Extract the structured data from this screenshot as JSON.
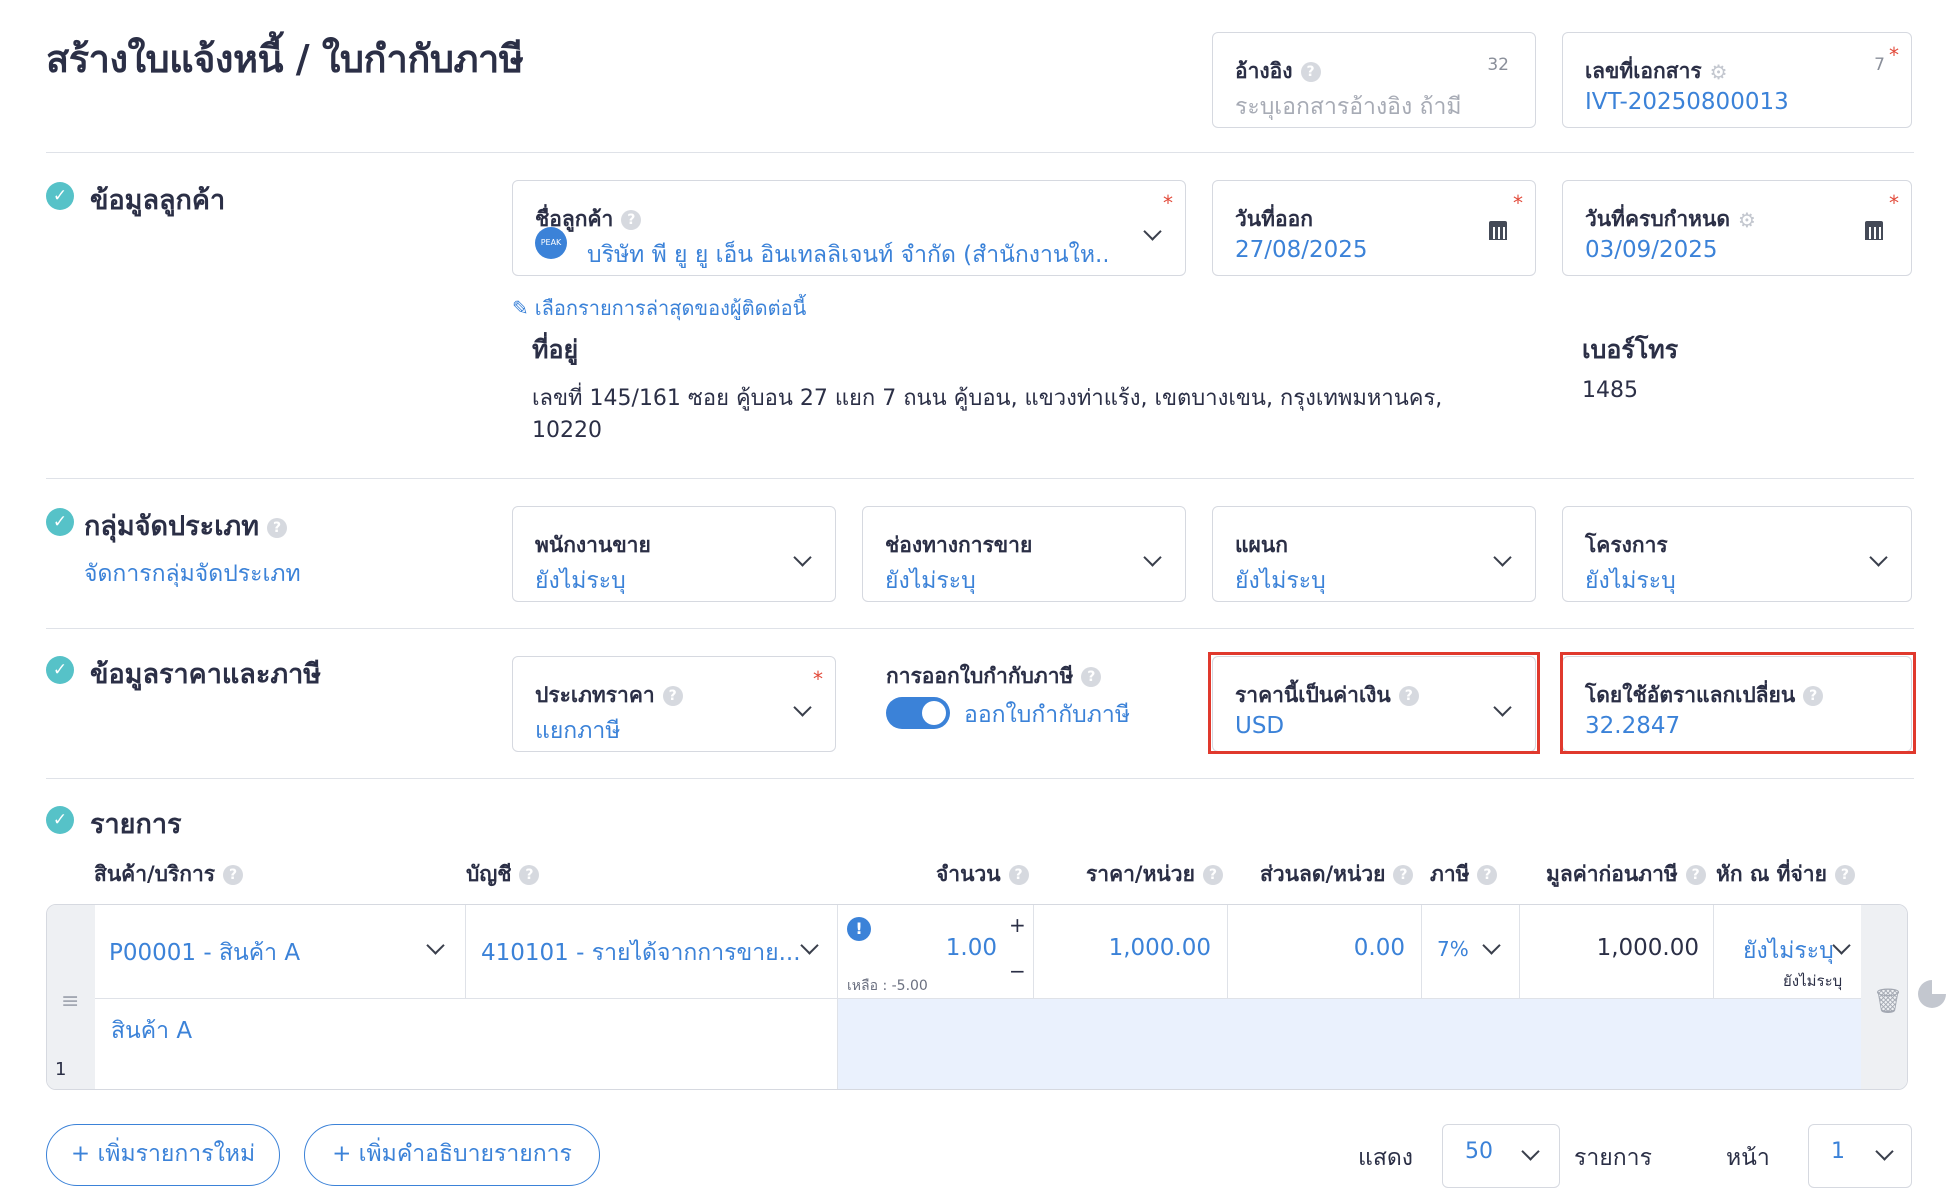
{
  "page": {
    "title": "สร้างใบแจ้งหนี้ / ใบกำกับภาษี"
  },
  "header": {
    "reference": {
      "label": "อ้างอิง",
      "placeholder": "ระบุเอกสารอ้างอิง ถ้ามี",
      "count": "32"
    },
    "doc_number": {
      "label": "เลขที่เอกสาร",
      "value": "IVT-20250800013",
      "count": "7"
    }
  },
  "customer": {
    "section_title": "ข้อมูลลูกค้า",
    "name_label": "ชื่อลูกค้า",
    "name_value": "บริษัท พี ยู ยู เอ็น อินเทลลิเจนท์ จำกัด (สำนักงานให...",
    "logo_text": "PEAK",
    "issue_date_label": "วันที่ออก",
    "issue_date": "27/08/2025",
    "due_date_label": "วันที่ครบกำหนด",
    "due_date": "03/09/2025",
    "recent_link": "เลือกรายการล่าสุดของผู้ติดต่อนี้",
    "address_label": "ที่อยู่",
    "address_line1": "เลขที่ 145/161 ซอย คู้บอน 27 แยก 7 ถนน คู้บอน, แขวงท่าแร้ง, เขตบางเขน, กรุงเทพมหานคร,",
    "address_line2": "10220",
    "phone_label": "เบอร์โทร",
    "phone": "1485"
  },
  "classification": {
    "section_title": "กลุ่มจัดประเภท",
    "manage_link": "จัดการกลุ่มจัดประเภท",
    "fields": [
      {
        "label": "พนักงานขาย",
        "value": "ยังไม่ระบุ"
      },
      {
        "label": "ช่องทางการขาย",
        "value": "ยังไม่ระบุ"
      },
      {
        "label": "แผนก",
        "value": "ยังไม่ระบุ"
      },
      {
        "label": "โครงการ",
        "value": "ยังไม่ระบุ"
      }
    ]
  },
  "pricing": {
    "section_title": "ข้อมูลราคาและภาษี",
    "price_type_label": "ประเภทราคา",
    "price_type_value": "แยกภาษี",
    "tax_invoice_label": "การออกใบกำกับภาษี",
    "tax_invoice_toggle_text": "ออกใบกำกับภาษี",
    "currency_label": "ราคานี้เป็นค่าเงิน",
    "currency_value": "USD",
    "exchange_label": "โดยใช้อัตราแลกเปลี่ยน",
    "exchange_value": "32.2847"
  },
  "items": {
    "section_title": "รายการ",
    "columns": [
      "สินค้า/บริการ",
      "บัญชี",
      "จำนวน",
      "ราคา/หน่วย",
      "ส่วนลด/หน่วย",
      "ภาษี",
      "มูลค่าก่อนภาษี",
      "หัก ณ ที่จ่าย"
    ],
    "rows": [
      {
        "index": "1",
        "product": "P00001 - สินค้า A",
        "account": "410101 - รายได้จากการขาย...",
        "quantity": "1.00",
        "remaining": "เหลือ : -5.00",
        "unit_price": "1,000.00",
        "discount": "0.00",
        "tax": "7%",
        "pre_tax": "1,000.00",
        "withholding": "ยังไม่ระบุ",
        "withholding_sub": "ยังไม่ระบุ",
        "description": "สินค้า A"
      }
    ]
  },
  "footer": {
    "add_item": "+ เพิ่มรายการใหม่",
    "add_desc": "+ เพิ่มคำอธิบายรายการ",
    "show_label": "แสดง",
    "show_value": "50",
    "items_label": "รายการ",
    "page_label": "หน้า",
    "page_value": "1"
  },
  "colors": {
    "accent": "#3b82d8",
    "highlight": "#e0392d",
    "check": "#56c2c8"
  }
}
